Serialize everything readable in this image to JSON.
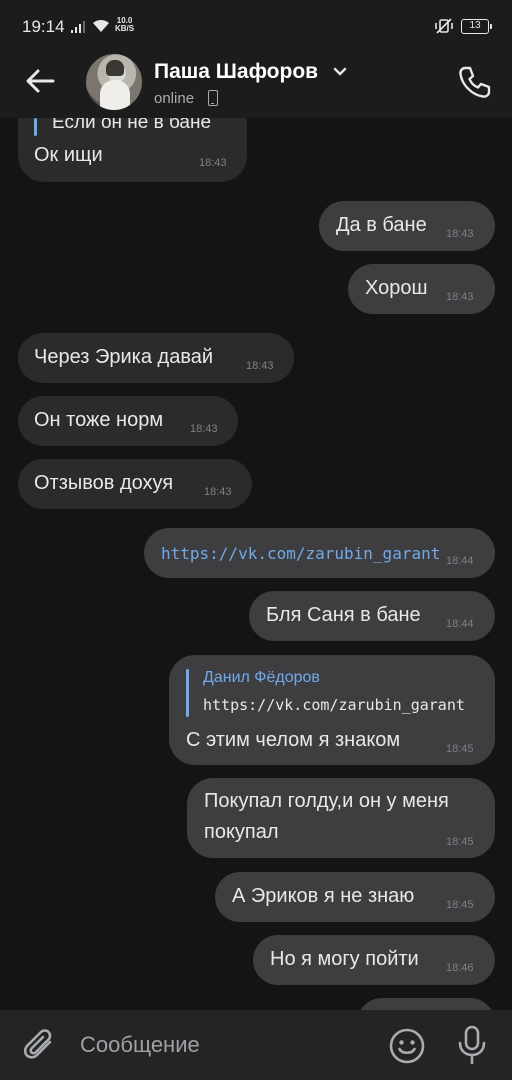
{
  "status_bar": {
    "time": "19:14",
    "net_speed_value": "10.0",
    "net_speed_unit": "KB/S",
    "battery": "13"
  },
  "header": {
    "contact_name": "Паша Шафоров",
    "status": "online"
  },
  "messages": [
    {
      "direction": "in",
      "quote": "Если он не в бане",
      "text": "Ок ищи",
      "time": "18:43"
    },
    {
      "direction": "out",
      "text": "Да в бане",
      "time": "18:43"
    },
    {
      "direction": "out",
      "text": "Хорош",
      "time": "18:43"
    },
    {
      "direction": "in",
      "text": "Через Эрика давай",
      "time": "18:43"
    },
    {
      "direction": "in",
      "text": "Он тоже норм",
      "time": "18:43"
    },
    {
      "direction": "in",
      "text": "Отзывов дохуя",
      "time": "18:43"
    },
    {
      "direction": "out",
      "text": "https://vk.com/zarubin_garant",
      "time": "18:44",
      "is_link": true
    },
    {
      "direction": "out",
      "text": "Бля Саня в бане",
      "time": "18:44"
    },
    {
      "direction": "out",
      "reply_author": "Данил Фёдоров",
      "reply_text": "https://vk.com/zarubin_garant",
      "text": "С этим челом я знаком",
      "time": "18:45"
    },
    {
      "direction": "out",
      "text_line1": "Покупал голду,и он у меня",
      "text_line2": "покупал",
      "time": "18:45"
    },
    {
      "direction": "out",
      "text": "А Эриков я не знаю",
      "time": "18:45"
    },
    {
      "direction": "out",
      "text": "Но я могу пойти",
      "time": "18:46"
    }
  ],
  "composer": {
    "placeholder": "Сообщение"
  },
  "colors": {
    "background": "#141414",
    "incoming_bubble": "#2b2b2c",
    "outgoing_bubble": "#3e3e40",
    "link": "#71aaeb"
  }
}
